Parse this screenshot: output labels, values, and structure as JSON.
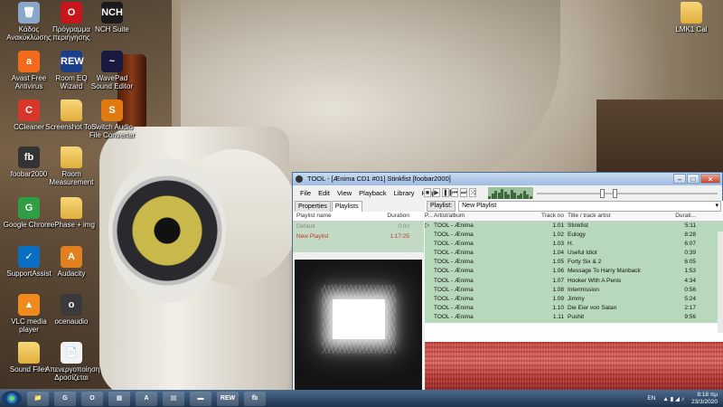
{
  "desktop": {
    "icons": [
      {
        "label": "Κάδος Ανακύκλωσης",
        "glyph": "🗑",
        "color": "#8aa6c8"
      },
      {
        "label": "Πρόγραμμα περιήγησης",
        "glyph": "O",
        "color": "#c8161d"
      },
      {
        "label": "NCH Suite",
        "glyph": "NCH",
        "color": "#1b1b1b"
      },
      {
        "label": "Avast Free Antivirus",
        "glyph": "a",
        "color": "#f26b1d"
      },
      {
        "label": "Room EQ Wizard",
        "glyph": "REW",
        "color": "#1b3f8b"
      },
      {
        "label": "WavePad Sound Editor",
        "glyph": "~",
        "color": "#1a1a40"
      },
      {
        "label": "CCleaner",
        "glyph": "C",
        "color": "#d9362b"
      },
      {
        "label": "Screenshot Tool",
        "glyph": "",
        "color": "folder"
      },
      {
        "label": "Switch Audio File Converter",
        "glyph": "S",
        "color": "#e07a10"
      },
      {
        "label": "foobar2000",
        "glyph": "fb",
        "color": "#333333"
      },
      {
        "label": "Room Measurement",
        "glyph": "",
        "color": "folder"
      },
      {
        "label": "Google Chrome",
        "glyph": "G",
        "color": "#2f9e44"
      },
      {
        "label": "rePhase + img",
        "glyph": "",
        "color": "folder"
      },
      {
        "label": "SupportAssist",
        "glyph": "✓",
        "color": "#0a6fc2"
      },
      {
        "label": "Audacity",
        "glyph": "A",
        "color": "#e0801e"
      },
      {
        "label": "VLC media player",
        "glyph": "▲",
        "color": "#f08a1c"
      },
      {
        "label": "ocenaudio",
        "glyph": "o",
        "color": "#3a3a3a"
      },
      {
        "label": "Sound Files",
        "glyph": "",
        "color": "folder"
      },
      {
        "label": "Απενεργοποίηση Δροσίζεται",
        "glyph": "📄",
        "color": "#f2f2f2"
      },
      {
        "label": "LMK1 Cal",
        "glyph": "",
        "color": "folder"
      }
    ]
  },
  "window": {
    "title": "TOOL - [Ænima CD1 #01] Stinkfist  [foobar2000]",
    "menu": [
      "File",
      "Edit",
      "View",
      "Playback",
      "Library",
      "Help"
    ],
    "transport": [
      "■",
      "▶",
      "❚❚",
      "⏮",
      "⏭",
      "⤨"
    ],
    "left_tabs": [
      "Properties",
      "Playlists"
    ],
    "playlist_header": {
      "name": "Playlist name",
      "duration": "Duration"
    },
    "playlists": [
      {
        "name": "Default",
        "duration": "0:00"
      },
      {
        "name": "New Playlist",
        "duration": "1:17:25"
      }
    ],
    "playlist_label": "Playlist:",
    "playlist_selected": "New Playlist",
    "columns": {
      "indicator": "P...",
      "artist": "Artist/album",
      "trackno": "Track no",
      "title": "Title / track artist",
      "duration": "Durati..."
    },
    "tracks": [
      {
        "ind": "▷",
        "artist": "TOOL - Ænima",
        "no": "1.01",
        "title": "Stinkfist",
        "dur": "5:11"
      },
      {
        "ind": "",
        "artist": "TOOL - Ænima",
        "no": "1.02",
        "title": "Eulogy",
        "dur": "8:28"
      },
      {
        "ind": "",
        "artist": "TOOL - Ænima",
        "no": "1.03",
        "title": "H.",
        "dur": "6:07"
      },
      {
        "ind": "",
        "artist": "TOOL - Ænima",
        "no": "1.04",
        "title": "Useful Idiot",
        "dur": "0:39"
      },
      {
        "ind": "",
        "artist": "TOOL - Ænima",
        "no": "1.05",
        "title": "Forty Six & 2",
        "dur": "6:05"
      },
      {
        "ind": "",
        "artist": "TOOL - Ænima",
        "no": "1.06",
        "title": "Message To Harry Manback",
        "dur": "1:53"
      },
      {
        "ind": "",
        "artist": "TOOL - Ænima",
        "no": "1.07",
        "title": "Hooker With A Penis",
        "dur": "4:34"
      },
      {
        "ind": "",
        "artist": "TOOL - Ænima",
        "no": "1.08",
        "title": "Intermission",
        "dur": "0:56"
      },
      {
        "ind": "",
        "artist": "TOOL - Ænima",
        "no": "1.09",
        "title": "Jimmy",
        "dur": "5:24"
      },
      {
        "ind": "",
        "artist": "TOOL - Ænima",
        "no": "1.10",
        "title": "Die Eier von Satan",
        "dur": "2:17"
      },
      {
        "ind": "",
        "artist": "TOOL - Ænima",
        "no": "1.11",
        "title": "Pushit",
        "dur": "9:56"
      }
    ],
    "seek_position": 0.42,
    "volume_position": 0.35
  },
  "taskbar": {
    "apps": [
      "📁",
      "G",
      "O",
      "▦",
      "A",
      "▤",
      "▬",
      "REW",
      "fb"
    ],
    "language": "EN",
    "time": "8:18 πμ",
    "date": "23/3/2020"
  }
}
